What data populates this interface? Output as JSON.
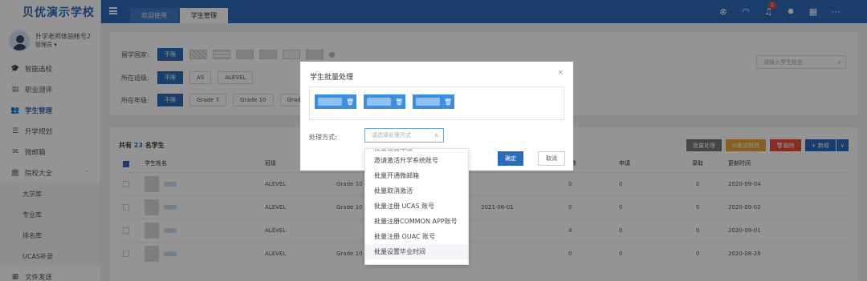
{
  "sidebar": {
    "brand": "贝优演示学校",
    "user_name": "升学老师体验帐号2",
    "user_role": "管理员 ▾",
    "items": [
      {
        "label": "智能选校",
        "icon": "mortarboard-icon",
        "glyph": "🎓"
      },
      {
        "label": "职业测评",
        "icon": "clipboard-icon",
        "glyph": "▤"
      },
      {
        "label": "学生管理",
        "icon": "students-icon",
        "glyph": "👥"
      },
      {
        "label": "升学规划",
        "icon": "planning-icon",
        "glyph": "☰"
      },
      {
        "label": "微邮箱",
        "icon": "mail-icon",
        "glyph": "✉"
      },
      {
        "label": "院校大全",
        "icon": "bank-icon",
        "glyph": "🏛"
      }
    ],
    "sub_items": [
      "大学库",
      "专业库",
      "排名库",
      "UCAS补录"
    ],
    "bottom_item": "文件发送"
  },
  "topbar": {
    "tabs": [
      "欢迎使用",
      "学生管理"
    ],
    "notification_count": "1"
  },
  "filters": {
    "country_label": "留学国家:",
    "class_label": "所在班级:",
    "grade_label": "所在年级:",
    "unlimited": "不限",
    "classes": [
      "AS",
      "ALEVEL"
    ],
    "grades": [
      "Grade 7",
      "Grade 10",
      "Grade 1"
    ],
    "search_placeholder": "请输入学生姓名"
  },
  "table": {
    "count_prefix": "共有 ",
    "count": "23",
    "count_suffix": " 名学生",
    "actions": {
      "batch": "批量处理",
      "sms": "发送短信",
      "delete": "删除",
      "add": "+ 新增",
      "more": "∨"
    },
    "headers": {
      "name": "学生姓名",
      "class": "班级",
      "a": "数",
      "apply": "申请",
      "offer": "录取",
      "update": "更新时间"
    },
    "rows": [
      {
        "class": "ALEVEL",
        "grade": "Grade 10",
        "date": "",
        "num": "0",
        "apply": "0",
        "offer": "0",
        "updated": "2020-09-04"
      },
      {
        "class": "ALEVEL",
        "grade": "Grade 10",
        "date": "2021-06-01",
        "num": "0",
        "apply": "0",
        "offer": "0",
        "updated": "2020-09-02"
      },
      {
        "class": "ALEVEL",
        "grade": "",
        "date": "",
        "num": "4",
        "apply": "0",
        "offer": "0",
        "updated": "2020-09-01"
      },
      {
        "class": "ALEVEL",
        "grade": "Grade 10",
        "date": "",
        "num": "0",
        "apply": "0",
        "offer": "0",
        "updated": "2020-08-28"
      }
    ]
  },
  "modal": {
    "title": "学生批量处理",
    "close": "×",
    "method_label": "处理方式:",
    "select_placeholder": "请选择处理方式",
    "confirm": "确定",
    "cancel": "取消"
  },
  "dropdown": {
    "options": [
      "批量设置年级",
      "邀请激活升学系统账号",
      "批量开通微邮箱",
      "批量取消激活",
      "批量注册 UCAS 账号",
      "批量注册COMMON APP账号",
      "批量注册 OUAC 账号",
      "批量设置毕业时间"
    ]
  },
  "colors": {
    "primary": "#2b6cb8",
    "danger": "#e74c3c",
    "warning": "#e8a23a"
  }
}
